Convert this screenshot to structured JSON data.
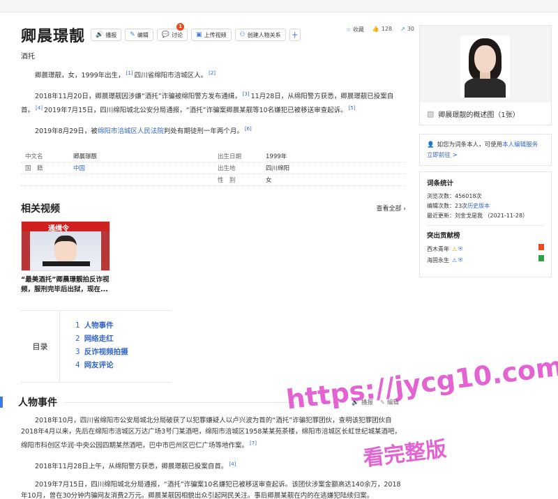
{
  "header": {
    "title": "卿晨璟靓",
    "subtitle": "酒托",
    "buttons": {
      "play": "播报",
      "edit": "编辑",
      "discuss": "讨论",
      "discuss_badge": "1",
      "upload_video": "上传视频",
      "create_relation": "创建人物关系",
      "plus": "+"
    },
    "stats": {
      "favorite": "收藏",
      "likes": "128",
      "shares": "30"
    }
  },
  "intro": {
    "p1": "卿晨璟靓，女，1999年出生，",
    "p1_ref1": "[1]",
    "p1_b": "四川省绵阳市涪城区人。",
    "p1_ref2": "[2]",
    "p2": "2018年11月20日，卿晨璟靓因涉嫌“酒托”诈骗被绵阳警方发布通缉，",
    "p2_ref1": "[3]",
    "p2_b": "11月28日，从绵阳警方获悉，卿晨璟靓已投案自首。",
    "p2_ref2": "[4]",
    "p2_c": "2019年7月15日，四川绵阳城北公安分局通报，“酒托”诈骗案卿晨某靓等10名嫌犯已被移送审查起诉。",
    "p2_ref3": "[5]",
    "p3_a": "2019年8月29日，被",
    "p3_link": "绵阳市涪城区人民法院",
    "p3_b": "判处有期徒刑一年两个月。",
    "p3_ref": "[6]"
  },
  "infobox": {
    "rows": [
      {
        "l1": "中文名",
        "v1": "卿晨璟靓",
        "l2": "出生日期",
        "v2": "1999年"
      },
      {
        "l1": "国　籍",
        "v1": "中国",
        "l2": "出生地",
        "v2": "四川绵阳"
      },
      {
        "l1": "",
        "v1": "",
        "l2": "性　别",
        "v2": "女"
      }
    ]
  },
  "videos": {
    "title": "相关视频",
    "see_all": "查看全部",
    "thumb_text": "通缉令",
    "item_title_1": "“最美酒托”卿晨璟靓拍反诈视",
    "item_title_2": "频，服刑完毕后出狱，现在..."
  },
  "toc": {
    "label": "目录",
    "items": [
      {
        "n": "1",
        "label": "人物事件"
      },
      {
        "n": "2",
        "label": "网络走红"
      },
      {
        "n": "3",
        "label": "反诈视频拍摄"
      },
      {
        "n": "4",
        "label": "网友评论"
      }
    ]
  },
  "section": {
    "title": "人物事件",
    "play": "播报",
    "edit": "编辑",
    "p1": "2018年10月，四川省绵阳市公安局城北分局破获了以犯罪嫌疑人以卢兴波为首的“酒托”诈骗犯罪团伙，查明该犯罪团伙自2018年4月以来，先后在绵阳市涪城区万达广场3号门某酒吧，绵阳市涪城区1958某某苑茶楼，绵阳市涪城区长虹世纪城某酒吧，绵阳市科创区华润·中央公园四期某然酒吧，巴中市巴州区巴仁广场等地作案。",
    "p1_ref": "[7]",
    "p2": "2018年11月28日上午，从绵阳警方获悉，卿晨璟靓已投案自首。",
    "p2_ref": "[4]",
    "p3": "2019年7月15日，四川绵阳城北分局通报，“酒托”诈骗案10名嫌犯已被移送审查起诉。该团伙涉案金额高达140余万，2018年10月，曾在30分钟内骗网友消费2万元。卿晨某靓因相貌出众引起网民关注。事后卿晨某靓在内的在逃嫌犯陆续归案。"
  },
  "sidebar": {
    "photo_caption": "卿晨璟靓的概述图（1张）",
    "claim_text": "如您为词条本人，可使用",
    "claim_link": "本人编辑服务",
    "claim_go": "立即前往 >",
    "stats_title": "词条统计",
    "views": "浏览次数：456018次",
    "edits_a": "编辑次数：23次",
    "edits_link": "历史版本",
    "updated": "最近更新：刘金戈是我 （2021-11-28）",
    "contrib_title": "突出贡献榜",
    "contrib": [
      {
        "name": "西木青年"
      },
      {
        "name": "海固永生"
      }
    ]
  },
  "watermark": {
    "line1": "https://jycg10.com",
    "line2": "看完整版"
  }
}
